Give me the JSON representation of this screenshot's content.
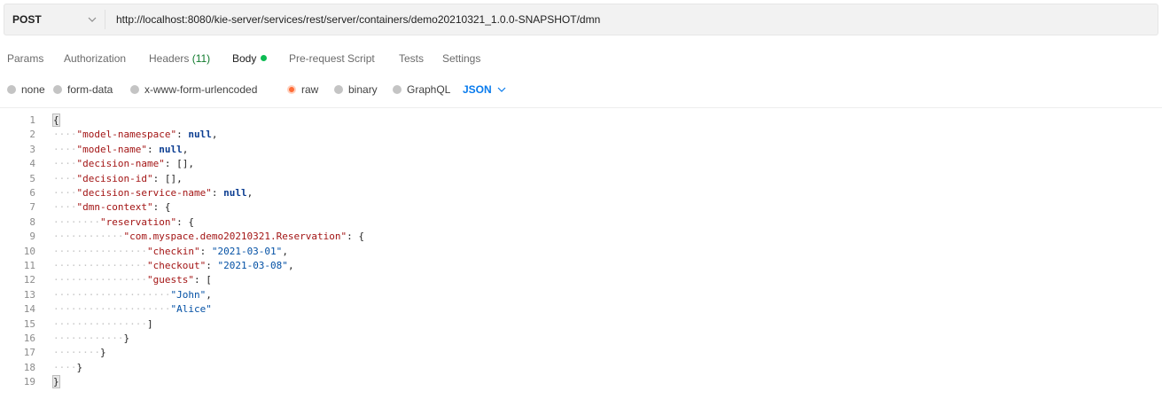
{
  "request": {
    "method": "POST",
    "url": "http://localhost:8080/kie-server/services/rest/server/containers/demo20210321_1.0.0-SNAPSHOT/dmn"
  },
  "tabs": [
    {
      "label": "Params"
    },
    {
      "label": "Authorization"
    },
    {
      "label": "Headers",
      "count": "(11)"
    },
    {
      "label": "Body",
      "active": true
    },
    {
      "label": "Pre-request Script"
    },
    {
      "label": "Tests"
    },
    {
      "label": "Settings"
    }
  ],
  "body_types": [
    {
      "label": "none"
    },
    {
      "label": "form-data"
    },
    {
      "label": "x-www-form-urlencoded"
    },
    {
      "label": "raw",
      "selected": true
    },
    {
      "label": "binary"
    },
    {
      "label": "GraphQL"
    }
  ],
  "language": "JSON",
  "colors": {
    "accent_orange": "#ff6c37",
    "link_blue": "#097bed",
    "active_dot_green": "#0cbb52"
  },
  "editor": {
    "lines": [
      {
        "n": "1",
        "indent": 0,
        "tokens": [
          {
            "t": "p",
            "v": "{"
          }
        ]
      },
      {
        "n": "2",
        "indent": 1,
        "tokens": [
          {
            "t": "k",
            "v": "\"model-namespace\""
          },
          {
            "t": "p",
            "v": ": "
          },
          {
            "t": "n",
            "v": "null"
          },
          {
            "t": "p",
            "v": ","
          }
        ]
      },
      {
        "n": "3",
        "indent": 1,
        "tokens": [
          {
            "t": "k",
            "v": "\"model-name\""
          },
          {
            "t": "p",
            "v": ": "
          },
          {
            "t": "n",
            "v": "null"
          },
          {
            "t": "p",
            "v": ","
          }
        ]
      },
      {
        "n": "4",
        "indent": 1,
        "tokens": [
          {
            "t": "k",
            "v": "\"decision-name\""
          },
          {
            "t": "p",
            "v": ": [],"
          }
        ]
      },
      {
        "n": "5",
        "indent": 1,
        "tokens": [
          {
            "t": "k",
            "v": "\"decision-id\""
          },
          {
            "t": "p",
            "v": ": [],"
          }
        ]
      },
      {
        "n": "6",
        "indent": 1,
        "tokens": [
          {
            "t": "k",
            "v": "\"decision-service-name\""
          },
          {
            "t": "p",
            "v": ": "
          },
          {
            "t": "n",
            "v": "null"
          },
          {
            "t": "p",
            "v": ","
          }
        ]
      },
      {
        "n": "7",
        "indent": 1,
        "tokens": [
          {
            "t": "k",
            "v": "\"dmn-context\""
          },
          {
            "t": "p",
            "v": ": {"
          }
        ]
      },
      {
        "n": "8",
        "indent": 2,
        "tokens": [
          {
            "t": "k",
            "v": "\"reservation\""
          },
          {
            "t": "p",
            "v": ": {"
          }
        ]
      },
      {
        "n": "9",
        "indent": 3,
        "tokens": [
          {
            "t": "k",
            "v": "\"com.myspace.demo20210321.Reservation\""
          },
          {
            "t": "p",
            "v": ": {"
          }
        ]
      },
      {
        "n": "10",
        "indent": 4,
        "tokens": [
          {
            "t": "k",
            "v": "\"checkin\""
          },
          {
            "t": "p",
            "v": ": "
          },
          {
            "t": "s",
            "v": "\"2021-03-01\""
          },
          {
            "t": "p",
            "v": ","
          }
        ]
      },
      {
        "n": "11",
        "indent": 4,
        "tokens": [
          {
            "t": "k",
            "v": "\"checkout\""
          },
          {
            "t": "p",
            "v": ": "
          },
          {
            "t": "s",
            "v": "\"2021-03-08\""
          },
          {
            "t": "p",
            "v": ","
          }
        ]
      },
      {
        "n": "12",
        "indent": 4,
        "tokens": [
          {
            "t": "k",
            "v": "\"guests\""
          },
          {
            "t": "p",
            "v": ": ["
          }
        ]
      },
      {
        "n": "13",
        "indent": 5,
        "tokens": [
          {
            "t": "s",
            "v": "\"John\""
          },
          {
            "t": "p",
            "v": ","
          }
        ]
      },
      {
        "n": "14",
        "indent": 5,
        "tokens": [
          {
            "t": "s",
            "v": "\"Alice\""
          }
        ]
      },
      {
        "n": "15",
        "indent": 4,
        "tokens": [
          {
            "t": "p",
            "v": "]"
          }
        ]
      },
      {
        "n": "16",
        "indent": 3,
        "tokens": [
          {
            "t": "p",
            "v": "}"
          }
        ]
      },
      {
        "n": "17",
        "indent": 2,
        "tokens": [
          {
            "t": "p",
            "v": "}"
          }
        ]
      },
      {
        "n": "18",
        "indent": 1,
        "tokens": [
          {
            "t": "p",
            "v": "}"
          }
        ]
      },
      {
        "n": "19",
        "indent": 0,
        "tokens": [
          {
            "t": "p",
            "v": "}"
          }
        ]
      }
    ]
  }
}
